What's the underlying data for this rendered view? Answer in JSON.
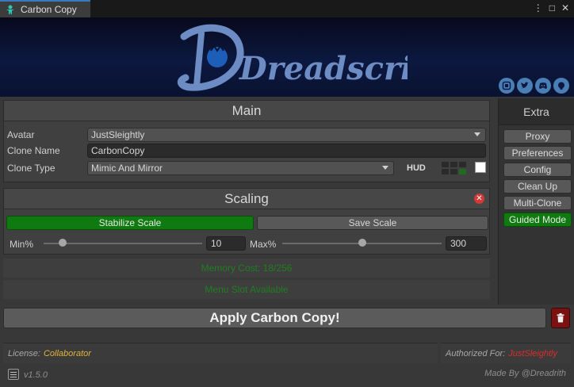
{
  "window": {
    "title": "Carbon Copy",
    "controls": [
      "⋮",
      "□",
      "✕"
    ]
  },
  "banner": {
    "logo_text": "Dreadscripts",
    "socials": [
      "website-icon",
      "twitter-icon",
      "discord-icon",
      "github-icon"
    ]
  },
  "main": {
    "title": "Main",
    "avatar_label": "Avatar",
    "avatar_value": "JustSleightly",
    "clone_name_label": "Clone Name",
    "clone_name_value": "CarbonCopy",
    "clone_type_label": "Clone Type",
    "clone_type_value": "Mimic And Mirror",
    "hud_label": "HUD"
  },
  "scaling": {
    "title": "Scaling",
    "stabilize_label": "Stabilize Scale",
    "save_label": "Save Scale",
    "min_label": "Min%",
    "min_value": "10",
    "max_label": "Max%",
    "max_value": "300",
    "min_slider_fraction": 0.12,
    "max_slider_fraction": 0.5
  },
  "status": {
    "memory": "Memory Cost: 18/256",
    "menu": "Menu Slot Available",
    "color": "#1f7f1f"
  },
  "extra": {
    "title": "Extra",
    "items": [
      {
        "label": "Proxy",
        "active": false
      },
      {
        "label": "Preferences",
        "active": false
      },
      {
        "label": "Config",
        "active": false
      },
      {
        "label": "Clean Up",
        "active": false
      },
      {
        "label": "Multi-Clone",
        "active": false
      },
      {
        "label": "Guided Mode",
        "active": true
      }
    ]
  },
  "apply": {
    "label": "Apply Carbon Copy!"
  },
  "footer": {
    "license_label": "License:",
    "license_value": "Collaborator",
    "authorized_label": "Authorized For:",
    "authorized_value": "JustSleightly",
    "version": "v1.5.0",
    "made_by": "Made By @Dreadrith"
  },
  "colors": {
    "accent_green": "#0f7a0f",
    "danger": "#d23a3a",
    "gold": "#e2b33a"
  }
}
